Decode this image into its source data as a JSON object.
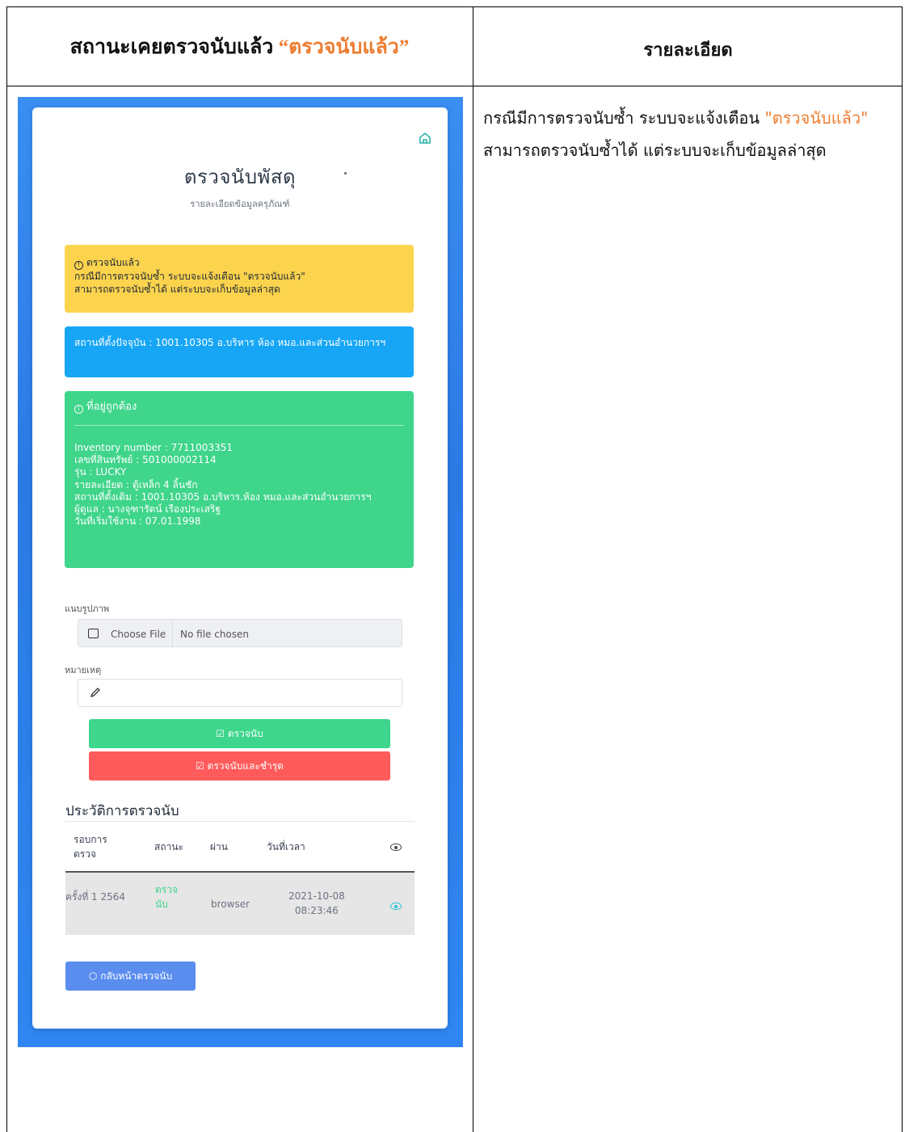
{
  "header": {
    "left_prefix": "สถานะเคยตรวจนับแล้ว",
    "left_accent": "“ตรวจนับแล้ว”",
    "right": "รายละเอียด"
  },
  "description": {
    "part1": "กรณีมีการตรวจนับซ้ำ ระบบจะแจ้งเตือน ",
    "accent": "\"ตรวจนับแล้ว\"",
    "part2": "  สามารถตรวจนับซ้ำได้ แต่ระบบจะเก็บข้อมูลล่าสุด"
  },
  "app": {
    "title": "ตรวจนับพัสดุ",
    "subtitle": "รายละเอียดข้อมูลครุภัณฑ์",
    "warning": {
      "title": "ตรวจนับแล้ว",
      "line1": "กรณีมีการตรวจนับซ้ำ ระบบจะแจ้งเตือน \"ตรวจนับแล้ว\"",
      "line2": "สามารถตรวจนับซ้ำได้ แต่ระบบจะเก็บข้อมูลล่าสุด"
    },
    "location_current": "สถานที่ตั้งปัจจุบัน : 1001.10305 อ.บริหาร ห้อง หมอ.และส่วนอำนวยการฯ",
    "status": {
      "title": "ที่อยู่ถูกต้อง",
      "lines": [
        "Inventory number : 7711003351",
        "เลขที่สินทรัพย์ : 501000002114",
        "รุ่น : LUCKY",
        "รายละเอียด : ตู้เหล็ก 4 ลิ้นชัก",
        "สถานที่ตั้งเดิม : 1001.10305 อ.บริหาร.ห้อง หมอ.และส่วนอำนวยการฯ",
        "ผู้ดูแล : นางจุฑารัตน์ เรืองประเสริฐ",
        "วันที่เริ่มใช้งาน : 07.01.1998"
      ]
    },
    "image_label": "แนบรูปภาพ",
    "choose_file": "Choose File",
    "no_file": "No file chosen",
    "note_label": "หมายเหตุ",
    "btn_count": "ตรวจนับ",
    "btn_count_damaged": "ตรวจนับและชำรุด",
    "history_title": "ประวัติการตรวจนับ",
    "history_headers": {
      "round_line1": "รอบการ",
      "round_line2": "ตรวจ",
      "status": "สถานะ",
      "via": "ผ่าน",
      "datetime": "วันที่เวลา"
    },
    "history_row": {
      "round": "ครั้งที่ 1 2564",
      "status_line1": "ตรวจ",
      "status_line2": "นับ",
      "via": "browser",
      "date": "2021-10-08",
      "time": "08:23:46"
    },
    "back_button": "กลับหน้าตรวจนับ"
  },
  "colors": {
    "accent_orange": "#ed7d31",
    "warning": "#fcd34d",
    "info": "#16a6f5",
    "success": "#3fd58a",
    "danger": "#ff5b5b",
    "primary": "#5b8def"
  }
}
